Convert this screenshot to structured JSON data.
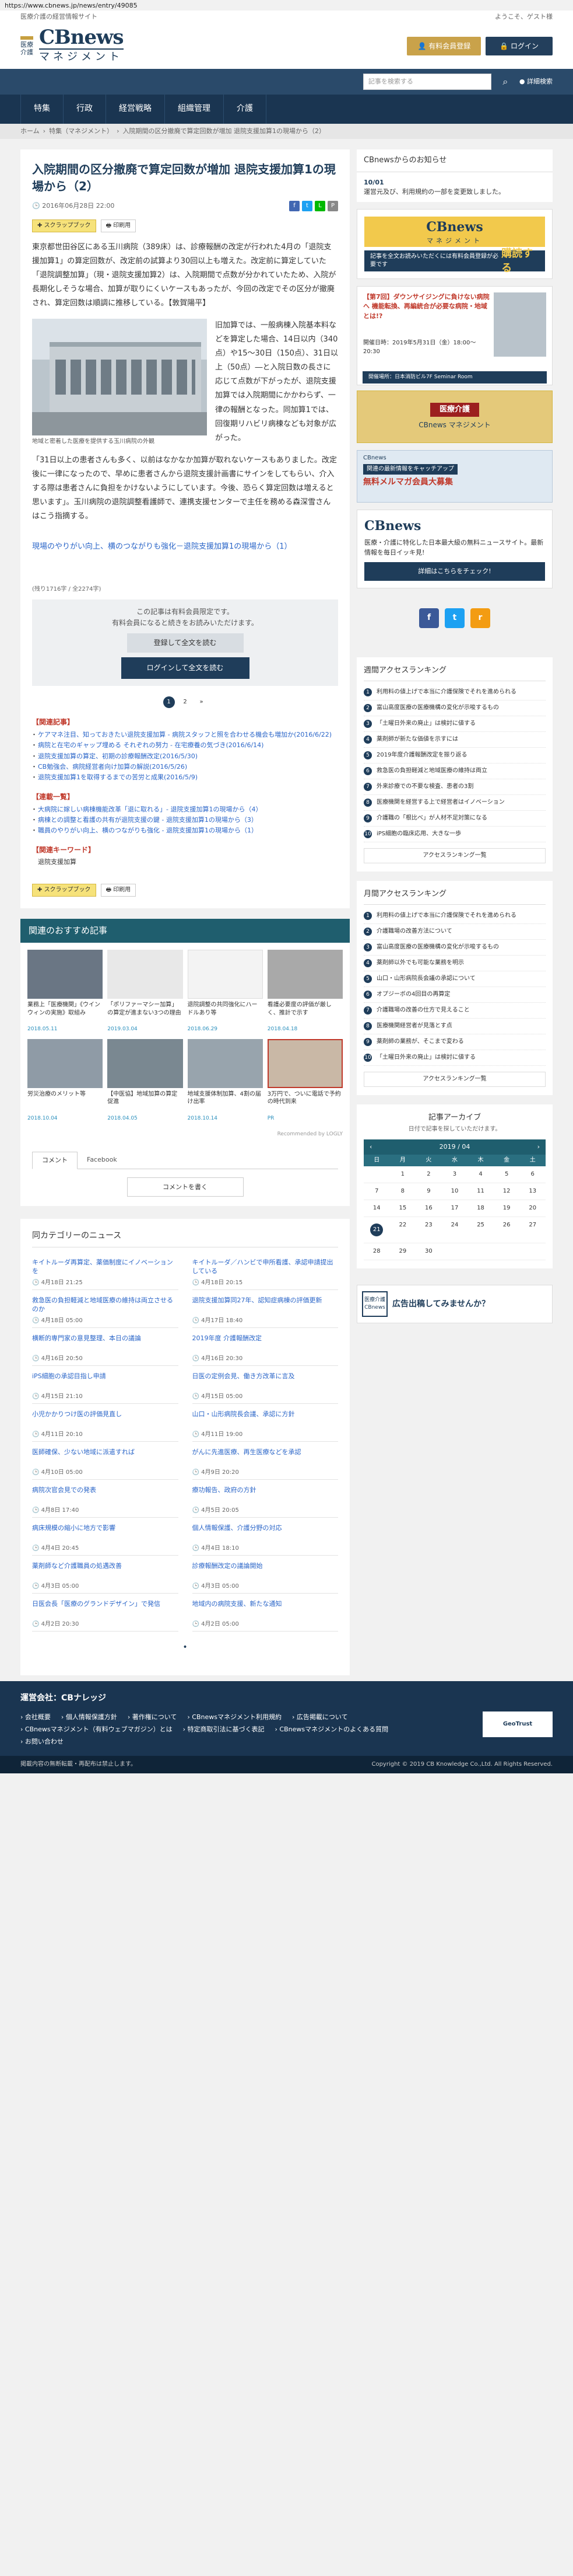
{
  "url": "https://www.cbnews.jp/news/entry/49085",
  "top": {
    "tagline": "医療介護の経営情報サイト",
    "welcome": "ようこそ、ゲスト様"
  },
  "logo": {
    "mark": "医療介護",
    "main": "CBnews",
    "sub": "マネジメント"
  },
  "header": {
    "register": "有料会員登録",
    "login": "ログイン",
    "search_placeholder": "記事を検索する",
    "advanced": "詳細検索"
  },
  "nav": [
    "特集",
    "行政",
    "経営戦略",
    "組織管理",
    "介護"
  ],
  "breadcrumb": [
    "ホーム",
    "特集（マネジメント）",
    "入院期間の区分撤廃で算定回数が増加 退院支援加算1の現場から（2）"
  ],
  "article": {
    "title": "入院期間の区分撤廃で算定回数が増加 退院支援加算1の現場から（2）",
    "date": "2016年06月28日 22:00",
    "scrap": "スクラップブック",
    "print": "印刷用",
    "p1": "東京都世田谷区にある玉川病院（389床）は、診療報酬の改定が行われた4月の「退院支援加算1」の算定回数が、改定前の試算より30回以上も増えた。改定前に算定していた「退院調整加算」（現・退院支援加算2）は、入院期間で点数が分かれていたため、入院が長期化しそうな場合、加算が取りにくいケースもあったが、今回の改定でその区分が撤廃され、算定回数は順調に推移している。【敦賀陽平】",
    "p2": "旧加算では、一般病棟入院基本料などを算定した場合、14日以内（340点）や15～30日（150点）、31日以上（50点）―と入院日数の長さに応じて点数が下がったが、退院支援加算では入院期間にかかわらず、一律の報酬となった。同加算1では、回復期リハビリ病棟なども対象が広がった。",
    "p3": "「31日以上の患者さんも多く、以前はなかなか加算が取れないケースもありました。改定後に一律になったので、早めに患者さんから退院支援計画書にサインをしてもらい、介入する際は患者さんに負担をかけないようにしています。今後、恐らく算定回数は増えると思います」。玉川病院の退院調整看護師で、連携支援センターで主任を務める森深雪さんはこう指摘する。",
    "photo_caption": "地域と密着した医療を提供する玉川病院の外観",
    "related": "現場のやりがい向上、横のつながりも強化－退院支援加算1の現場から（1）",
    "char_count": "(残り1716字 / 全2274字)"
  },
  "paywall": {
    "line1": "この記事は有料会員限定です。",
    "line2": "有料会員になると続きをお読みいただけます。",
    "register": "登録して全文を読む",
    "login": "ログインして全文を読む"
  },
  "pager": [
    "1",
    "2",
    "»"
  ],
  "related_heading": "【関連記事】",
  "related": [
    "ケアマネ注目、知っておきたい退院支援加算 - 病院スタッフと照を合わせる機会も増加か(2016/6/22)",
    "病院と在宅のギャップ埋める それぞれの努力 - 在宅療養の気づき(2016/6/14)",
    "退院支援加算の算定、初期の診療報酬改定(2016/5/30)",
    "CB勉強会、病院経営者向け加算の解説(2016/5/26)",
    "退院支援加算1を取得するまでの苦労と成果(2016/5/9)"
  ],
  "series_heading": "【連載一覧】",
  "series": [
    "大病院に嫁しい病棟機能改革「退に取れる」- 退院支援加算1の現場から（4）",
    "病棟との調整と看護の共有が退院支援の鍵 - 退院支援加算1の現場から（3）",
    "職員のやりがい向上、横のつながりも強化 - 退院支援加算1の現場から（1）"
  ],
  "keyword_heading": "【関連キーワード】",
  "keyword": "退院支援加算",
  "recommend": {
    "heading": "関連のおすすめ記事",
    "items": [
      {
        "title": "業務上「医療機関」《ウインウィンの実施》取組み",
        "date": "2018.05.11"
      },
      {
        "title": "「ポリファーマシー加算」の算定が進まない3つの理由",
        "date": "2019.03.04"
      },
      {
        "title": "退院調整の共同強化にハードルあり等",
        "date": "2018.06.29"
      },
      {
        "title": "看護必要度の評価が厳しく、推計で示す",
        "date": "2018.04.18"
      },
      {
        "title": "労災治療のメリット等",
        "date": "2018.10.04"
      },
      {
        "title": "【中医協】地域加算の算定促進",
        "date": "2018.04.05"
      },
      {
        "title": "地域支援体制加算、4割の届け出率",
        "date": "2018.10.14"
      },
      {
        "title": "3万円で、ついに電話で予約の時代到来",
        "date": "PR"
      }
    ],
    "powered": "Recommended by LOGLY"
  },
  "comments": {
    "tab1": "コメント",
    "tab2": "Facebook",
    "write": "コメントを書く"
  },
  "catnews": {
    "heading": "同カテゴリーのニュース",
    "items": [
      {
        "title": "キイトルーダ再算定、薬価制度にイノベーションを",
        "date": "4月18日 21:25"
      },
      {
        "title": "キイトルーダ／ハンビで申所看護、承認申請提出している",
        "date": "4月18日 20:15"
      },
      {
        "title": "救急医の負担軽減と地域医療の維持は両立させるのか",
        "date": "4月18日 05:00"
      },
      {
        "title": "退院支援加算同27年、認知症病棟の評価更新",
        "date": "4月17日 18:40"
      },
      {
        "title": "横断的専門家の意見整理、本日の議論",
        "date": "4月16日 20:50"
      },
      {
        "title": "2019年度 介護報酬改定",
        "date": "4月16日 20:30"
      },
      {
        "title": "iPS細胞の承認目指し申請",
        "date": "4月15日 21:10"
      },
      {
        "title": "日医の定例会見、働き方改革に言及",
        "date": "4月15日 05:00"
      },
      {
        "title": "小児かかりつけ医の評価見直し",
        "date": "4月11日 20:10"
      },
      {
        "title": "山口・山形病院長会議、承認に方針",
        "date": "4月11日 19:00"
      },
      {
        "title": "医師確保、少ない地域に派遣すれば",
        "date": "4月10日 05:00"
      },
      {
        "title": "がんに先進医療、再生医療などを承認",
        "date": "4月9日 20:20"
      },
      {
        "title": "病院次官会見での発表",
        "date": "4月8日 17:40"
      },
      {
        "title": "療功報告、政府の方針",
        "date": "4月5日 20:05"
      },
      {
        "title": "病床規模の縮小に地方で影響",
        "date": "4月4日 20:45"
      },
      {
        "title": "個人情報保護、介護分野の対応",
        "date": "4月4日 18:10"
      },
      {
        "title": "薬剤師など介護職員の処遇改善",
        "date": "4月3日 05:00"
      },
      {
        "title": "診療報酬改定の議論開始",
        "date": "4月3日 05:00"
      },
      {
        "title": "日医会長「医療のグランドデザイン」で発信",
        "date": "4月2日 20:30"
      },
      {
        "title": "地域内の病院支援、新たな通知",
        "date": "4月2日 05:00"
      }
    ]
  },
  "sidebar": {
    "notice_title": "CBnewsからのお知らせ",
    "notice_date": "10/01",
    "notice_text": "運営元及び、利用規約の一部を変更致しました。",
    "ad1": {
      "t1": "CBnews",
      "t2": "マネジメント",
      "t3": "記事を全文お読みいただくには有料会員登録が必要です",
      "cta": "購読する"
    },
    "ad2": {
      "title": "【第7回】ダウンサイジングに負けない病院へ 機能転換、再編統合が必要な病院・地域とは!?",
      "sub": "開催日時：2019年5月31日（金）18:00～20:30",
      "place": "開催場所：日本消防ビル7F Seminar Room"
    },
    "ad3": {
      "a": "医療介護",
      "b": "CBnews マネジメント"
    },
    "ad4": {
      "a": "CBnews",
      "b": "関連の最新情報をキャッチアップ",
      "c": "無料メルマガ会員大募集"
    },
    "ad5": {
      "logo": "CBnews",
      "text": "医療・介護に特化した日本最大級の無料ニュースサイト。最新情報を毎日イッキ見!",
      "cta": "詳細はこちらをチェック!"
    },
    "socials": [
      "f",
      "t",
      "r"
    ],
    "weekly": {
      "heading": "週間アクセスランキング",
      "items": [
        "利用料の値上げで本当に介護保険でそれを進められる",
        "富山高度医療の医療機構の変化が示唆するもの",
        "「土曜日外来の廃止」は検討に値する",
        "薬剤師が新たな価値を示すには",
        "2019年度介護報酬改定を振り返る",
        "救急医の負担軽減と地域医療の維持は両立",
        "外来診療での不要な検査、患者の3割",
        "医療機関を経営する上で経営者はイノベーション",
        "介護職の「根比べ」が人材不足対策になる",
        "iPS細胞の臨床応用、大きな一歩"
      ],
      "more": "アクセスランキング一覧"
    },
    "monthly": {
      "heading": "月間アクセスランキング",
      "items": [
        "利用料の値上げで本当に介護保険でそれを進められる",
        "介護職場の改善方法について",
        "富山高度医療の医療機構の変化が示唆するもの",
        "薬剤師以外でも可能な業務を明示",
        "山口・山形病院長会議の承認について",
        "オプジーボの4回目の再算定",
        "介護職場の改善の仕方で見えること",
        "医療機関経営者が見落とす点",
        "薬剤師の業務が、そこまで変わる",
        "「土曜日外来の廃止」は検討に値する"
      ],
      "more": "アクセスランキング一覧"
    },
    "archive": {
      "heading": "記事アーカイブ",
      "sub": "日付で記事を探していただけます。",
      "month": "2019 / 04",
      "days_h": [
        "日",
        "月",
        "火",
        "水",
        "木",
        "金",
        "土"
      ],
      "days": [
        "",
        "1",
        "2",
        "3",
        "4",
        "5",
        "6",
        "7",
        "8",
        "9",
        "10",
        "11",
        "12",
        "13",
        "14",
        "15",
        "16",
        "17",
        "18",
        "19",
        "20",
        "21",
        "22",
        "23",
        "24",
        "25",
        "26",
        "27",
        "28",
        "29",
        "30",
        "",
        "",
        "",
        ""
      ],
      "selected": "21"
    },
    "ad6": {
      "mark": "医療介護 CBnews",
      "text": "広告出稿してみませんか？"
    }
  },
  "footer": {
    "org": "運営会社：CBナレッジ",
    "links": [
      "会社概要",
      "個人情報保護方針",
      "著作権について",
      "CBnewsマネジメント利用規約",
      "広告掲載について",
      "CBnewsマネジメント（有料ウェブマガジン）とは",
      "特定商取引法に基づく表記",
      "CBnewsマネジメントのよくある質問",
      "お問い合わせ"
    ],
    "badge": "GeoTrust",
    "notice": "掲載内容の無断転載・再配布は禁止します。",
    "copyright": "Copyright © 2019 CB Knowledge Co.,Ltd. All Rights Reserved."
  }
}
